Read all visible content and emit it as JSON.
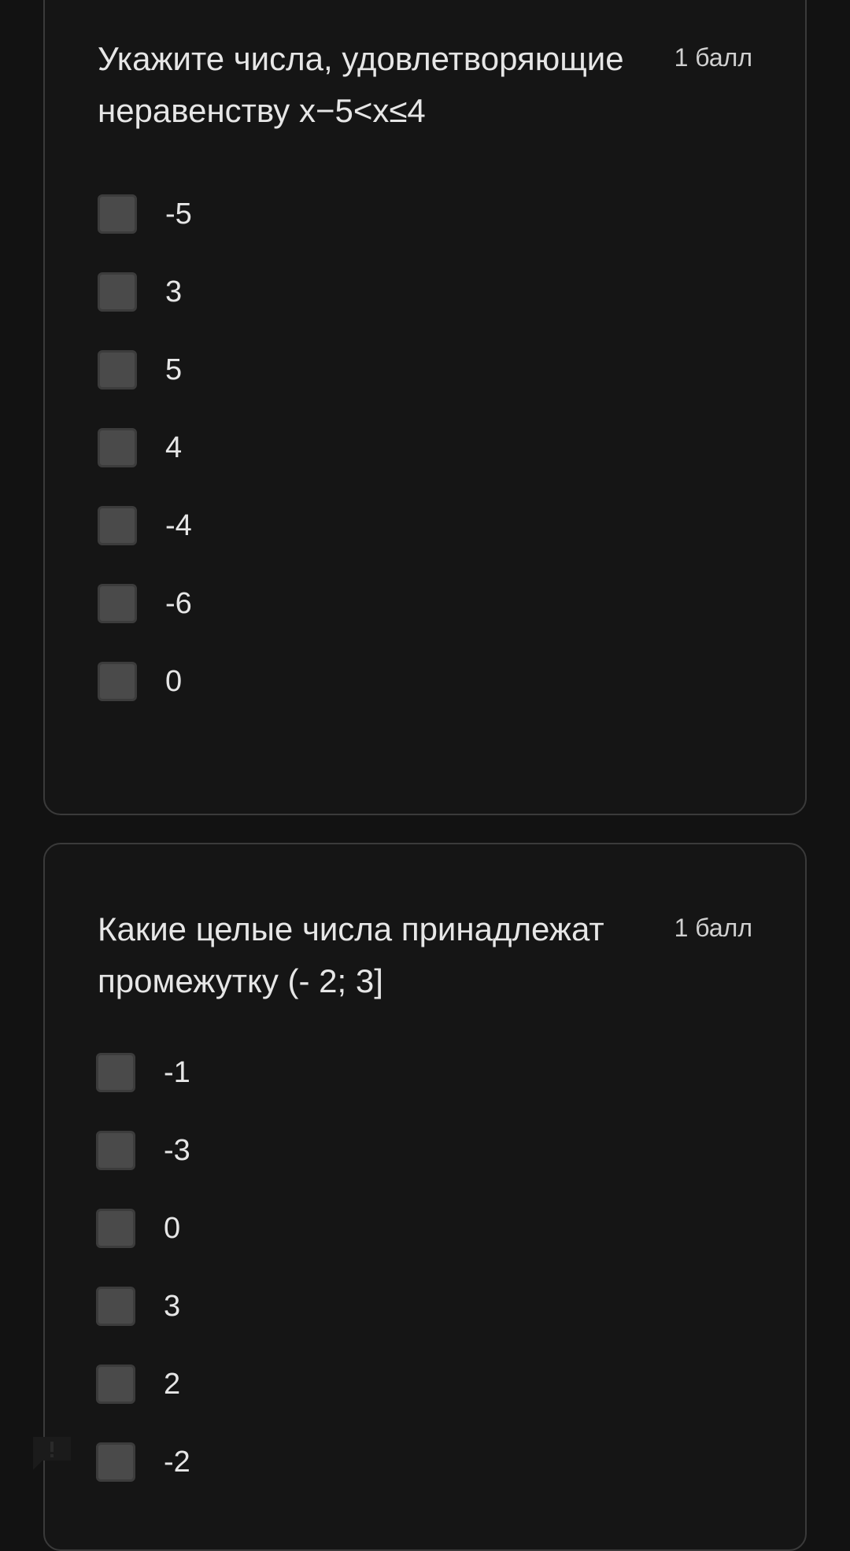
{
  "questions": [
    {
      "title": "Укажите числа, удовлетворяющие неравенству x−5<x≤4",
      "points": "1 балл",
      "options": [
        "-5",
        "3",
        "5",
        "4",
        "-4",
        "-6",
        "0"
      ]
    },
    {
      "title": "Какие целые числа принадлежат промежутку (- 2; 3]",
      "points": "1 балл",
      "options": [
        "-1",
        "-3",
        "0",
        "3",
        "2",
        "-2"
      ]
    }
  ],
  "icons": {
    "feedback": "report-feedback-icon"
  },
  "colors": {
    "background": "#121212",
    "card_border": "#3a3a3a",
    "checkbox_fill": "#4a4a4a",
    "text": "#e6e6e6"
  }
}
